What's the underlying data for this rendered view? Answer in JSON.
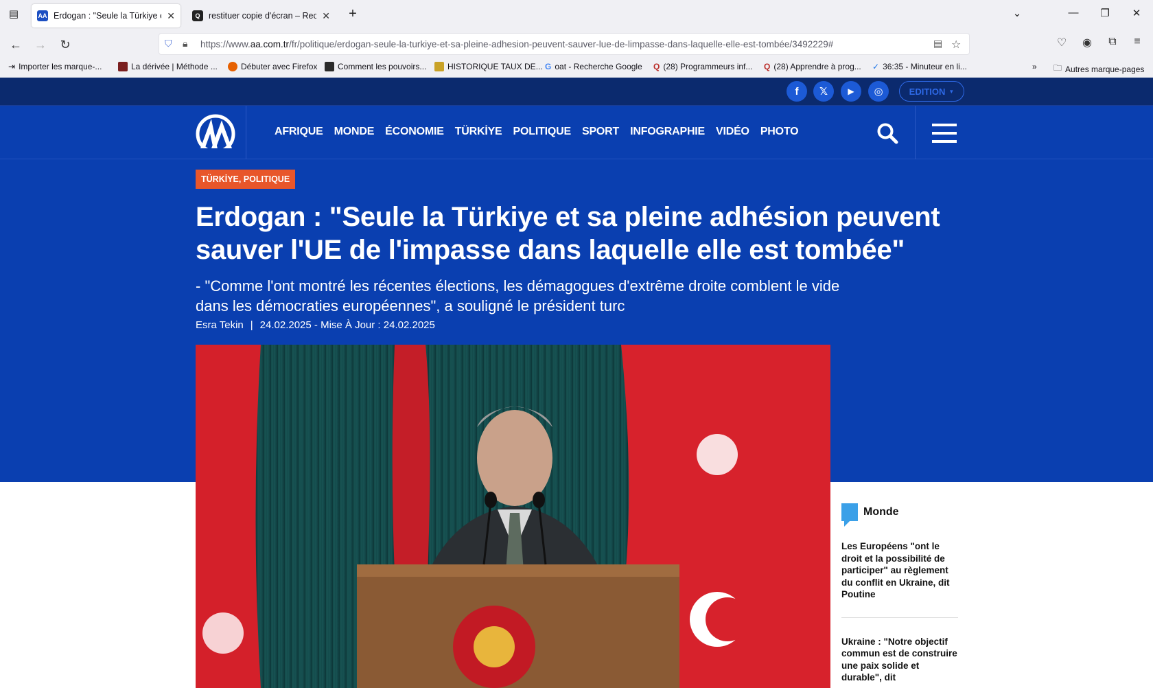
{
  "browser": {
    "tabs": [
      {
        "title": "Erdogan : \"Seule la Türkiye et sa",
        "active": true,
        "favicon": "AA"
      },
      {
        "title": "restituer copie d'écran – Recher",
        "active": false,
        "favicon": "Q"
      }
    ],
    "url_prefix": "https://www.",
    "url_domain": "aa.com.tr",
    "url_path": "/fr/politique/erdogan-seule-la-turkiye-et-sa-pleine-adhesion-peuvent-sauver-lue-de-limpasse-dans-laquelle-elle-est-tombée/3492229#",
    "bookmarks": [
      {
        "label": "Importer les marque-...",
        "color": "#555"
      },
      {
        "label": "La dérivée | Méthode ...",
        "color": "#7a1f1f"
      },
      {
        "label": "Débuter avec Firefox",
        "color": "#e66000"
      },
      {
        "label": "Comment les pouvoirs...",
        "color": "#2b2b2b"
      },
      {
        "label": "HISTORIQUE TAUX DE...",
        "color": "#c9a227"
      },
      {
        "label": "oat - Recherche Google",
        "color": "#4285f4"
      },
      {
        "label": "(28) Programmeurs inf...",
        "color": "#b92b27"
      },
      {
        "label": "(28) Apprendre à prog...",
        "color": "#b92b27"
      },
      {
        "label": "36:35 - Minuteur en li...",
        "color": "#1a73e8"
      }
    ],
    "other_bookmarks": "Autres marque-pages"
  },
  "site": {
    "edition_label": "EDITION",
    "social": [
      "f",
      "𝕏",
      "▶",
      "◎"
    ],
    "logo": "AA",
    "nav": [
      "AFRIQUE",
      "MONDE",
      "ÉCONOMIE",
      "TÜRKİYE",
      "POLITIQUE",
      "SPORT",
      "INFOGRAPHIE",
      "VIDÉO",
      "PHOTO"
    ]
  },
  "article": {
    "category": "TÜRKİYE, POLITIQUE",
    "headline": "Erdogan : \"Seule la Türkiye et sa pleine adhésion peuvent sauver l'UE de l'impasse dans laquelle elle est tombée\"",
    "subheadline": "- \"Comme l'ont montré les récentes élections, les démagogues d'extrême droite comblent le vide dans les démocraties européennes\", a souligné le président turc",
    "author": "Esra Tekin",
    "separator": "|",
    "date_line": "24.02.2025 - Mise À Jour : 24.02.2025"
  },
  "sidebar": {
    "heading": "Monde",
    "links": [
      "Les Européens \"ont le droit et la possibilité de participer\" au règlement du conflit en Ukraine, dit Poutine",
      "Ukraine : \"Notre objectif commun est de construire une paix solide et durable\", dit"
    ]
  }
}
